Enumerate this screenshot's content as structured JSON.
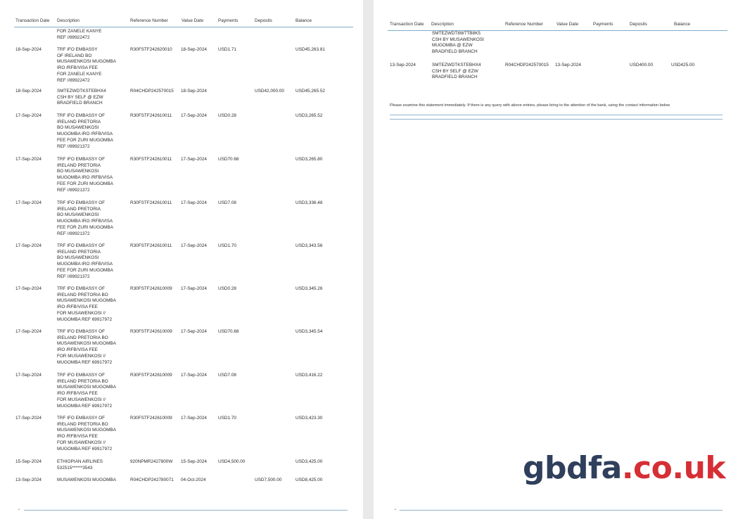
{
  "headers": [
    "Transaction Date",
    "Description",
    "Reference Number",
    "Value Date",
    "Payments",
    "Deposits",
    "Balance"
  ],
  "left_rows": [
    {
      "date": "",
      "desc": "FOR ZANELE KANYE\nREF //89922472",
      "ref": "",
      "vdate": "",
      "pay": "",
      "dep": "",
      "bal": ""
    },
    {
      "date": "18-Sep-2024",
      "desc": "TRF IFO EMBASSY\nOF IRELAND BO\nMUSAWENKOSI MUGOMBA\nIRO /RFB/VISA FEE\nFOR ZANELE KANYE\nREF //89922472",
      "ref": "R30FSTF242620010",
      "vdate": "18-Sep-2024",
      "pay": "USD1.71",
      "dep": "",
      "bal": "USD45,263.81"
    },
    {
      "date": "18-Sep-2024",
      "desc": "SMTEZWDTKSTEBHX4\nCSH BY SELF @ EZW\nBRADFIELD BRANCH",
      "ref": "R04CHDP242570015",
      "vdate": "18-Sep-2024",
      "pay": "",
      "dep": "USD42,000.00",
      "bal": "USD45,265.52"
    },
    {
      "date": "17-Sep-2024",
      "desc": "TRF IFO EMBASSY OF\nIRELAND PRETORIA\nBO MUSAWENKOSI\nMUGOMBA IRO /RFB/VISA\nFEE FOR ZURI MUGOMBA\nREF //89921372",
      "ref": "R30FSTF242610011",
      "vdate": "17-Sep-2024",
      "pay": "USD0.28",
      "dep": "",
      "bal": "USD3,265.52"
    },
    {
      "date": "17-Sep-2024",
      "desc": "TRF IFO EMBASSY OF\nIRELAND PRETORIA\nBO MUSAWENKOSI\nMUGOMBA IRO /RFB/VISA\nFEE FOR ZURI MUGOMBA\nREF //89921372",
      "ref": "R30FSTF242610011",
      "vdate": "17-Sep-2024",
      "pay": "USD70.68",
      "dep": "",
      "bal": "USD3,265.80"
    },
    {
      "date": "17-Sep-2024",
      "desc": "TRF IFO EMBASSY OF\nIRELAND PRETORIA\nBO MUSAWENKOSI\nMUGOMBA IRO /RFB/VISA\nFEE FOR ZURI MUGOMBA\nREF //89921372",
      "ref": "R30FSTF242610011",
      "vdate": "17-Sep-2024",
      "pay": "USD7.08",
      "dep": "",
      "bal": "USD3,336.48"
    },
    {
      "date": "17-Sep-2024",
      "desc": "TRF IFO EMBASSY OF\nIRELAND PRETORIA\nBO MUSAWENKOSI\nMUGOMBA IRO /RFB/VISA\nFEE FOR ZURI MUGOMBA\nREF //89921372",
      "ref": "R30FSTF242610011",
      "vdate": "17-Sep-2024",
      "pay": "USD1.70",
      "dep": "",
      "bal": "USD3,343.56"
    },
    {
      "date": "17-Sep-2024",
      "desc": "TRF IFO EMBASSY OF\nIRELAND PRETORIA BO\nMUSAWENKOSI MUGOMBA\nIRO /RFB/VISA FEE\nFOR MUSAWENKOSI //\nMUGOMBA REF 69917972",
      "ref": "R30FSTF242610009",
      "vdate": "17-Sep-2024",
      "pay": "USD0.28",
      "dep": "",
      "bal": "USD3,345.26"
    },
    {
      "date": "17-Sep-2024",
      "desc": "TRF IFO EMBASSY OF\nIRELAND PRETORIA BO\nMUSAWENKOSI MUGOMBA\nIRO /RFB/VISA FEE\nFOR MUSAWENKOSI //\nMUGOMBA REF 69917972",
      "ref": "R30FSTF242610009",
      "vdate": "17-Sep-2024",
      "pay": "USD70.68",
      "dep": "",
      "bal": "USD3,345.54"
    },
    {
      "date": "17-Sep-2024",
      "desc": "TRF IFO EMBASSY OF\nIRELAND PRETORIA BO\nMUSAWENKOSI MUGOMBA\nIRO /RFB/VISA FEE\nFOR MUSAWENKOSI //\nMUGOMBA REF 69917972",
      "ref": "R30FSTF242610009",
      "vdate": "17-Sep-2024",
      "pay": "USD7.08",
      "dep": "",
      "bal": "USD3,416.22"
    },
    {
      "date": "17-Sep-2024",
      "desc": "TRF IFO EMBASSY OF\nIRELAND PRETORIA BO\nMUSAWENKOSI MUGOMBA\nIRO /RFB/VISA FEE\nFOR MUSAWENKOSI //\nMUGOMBA REF 69917972",
      "ref": "R30FSTF242610009",
      "vdate": "17-Sep-2024",
      "pay": "USD1.70",
      "dep": "",
      "bal": "USD3,423.30"
    },
    {
      "date": "15-Sep-2024",
      "desc": "ETHIOPIAN AIRLINES\n532515******3543",
      "ref": "920NPMR2427800W",
      "vdate": "15-Sep-2024",
      "pay": "USD4,500.00",
      "dep": "",
      "bal": "USD3,425.00"
    },
    {
      "date": "13-Sep-2024",
      "desc": "MUSAWENKOSI MUGOMBA",
      "ref": "R04CHDP242780071",
      "vdate": "04-Oct-2024",
      "pay": "",
      "dep": "USD7,500.00",
      "bal": "USD8,425.00"
    }
  ],
  "right_rows": [
    {
      "date": "",
      "desc": "SMTEZWDT8W7TB8K5\nCSH BY MUSAWENKOSI\nMUGOMBA @ EZW\nBRADFIELD BRANCH",
      "ref": "",
      "vdate": "",
      "pay": "",
      "dep": "",
      "bal": ""
    },
    {
      "date": "13-Sep-2024",
      "desc": "SMTEZWDTKSTEBHX4\nCSH BY SELF @ EZW\nBRADFIELD BRANCH",
      "ref": "R04CHDP242570015",
      "vdate": "13-Sep-2024",
      "pay": "",
      "dep": "USD400.00",
      "bal": "USD425.00"
    }
  ],
  "notice": "Please examine this statement immediately. If there is any query with above entries, please bring to the attention of the bank, using the contact information below",
  "watermark": {
    "part1": "gbdfa",
    "part2": ".co.uk"
  },
  "colors": {
    "rule": "#7eaecf",
    "watermark_dark": "#2f3f5c",
    "watermark_red": "#d62e35"
  }
}
